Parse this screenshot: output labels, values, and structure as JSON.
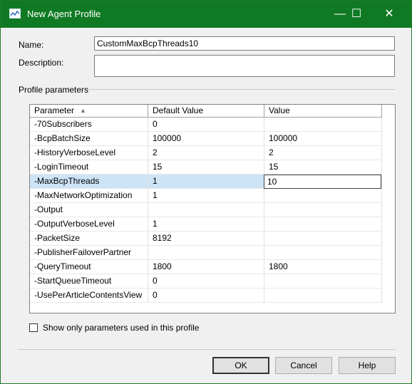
{
  "window": {
    "title": "New Agent Profile",
    "minimize": "—",
    "maximize": "☐",
    "close": "✕"
  },
  "form": {
    "name_label": "Name:",
    "name_value": "CustomMaxBcpThreads10",
    "description_label": "Description:",
    "description_value": "",
    "group_label": "Profile parameters"
  },
  "grid": {
    "columns": [
      "Parameter",
      "Default Value",
      "Value"
    ],
    "sort_indicator": "▲",
    "rows": [
      {
        "param": "-70Subscribers",
        "default": "0",
        "value": ""
      },
      {
        "param": "-BcpBatchSize",
        "default": "100000",
        "value": "100000"
      },
      {
        "param": "-HistoryVerboseLevel",
        "default": "2",
        "value": "2"
      },
      {
        "param": "-LoginTimeout",
        "default": "15",
        "value": "15"
      },
      {
        "param": "-MaxBcpThreads",
        "default": "1",
        "value": "10"
      },
      {
        "param": "-MaxNetworkOptimization",
        "default": "1",
        "value": ""
      },
      {
        "param": "-Output",
        "default": "",
        "value": ""
      },
      {
        "param": "-OutputVerboseLevel",
        "default": "1",
        "value": ""
      },
      {
        "param": "-PacketSize",
        "default": "8192",
        "value": ""
      },
      {
        "param": "-PublisherFailoverPartner",
        "default": "",
        "value": ""
      },
      {
        "param": "-QueryTimeout",
        "default": "1800",
        "value": "1800"
      },
      {
        "param": "-StartQueueTimeout",
        "default": "0",
        "value": ""
      },
      {
        "param": "-UsePerArticleContentsView",
        "default": "0",
        "value": ""
      }
    ],
    "selected_index": 4
  },
  "filter": {
    "checkbox_label": "Show only parameters used in this profile",
    "checked": false
  },
  "buttons": {
    "ok": "OK",
    "cancel": "Cancel",
    "help": "Help"
  },
  "colors": {
    "titlebar": "#0f7a23",
    "selection": "#cde4f7"
  }
}
